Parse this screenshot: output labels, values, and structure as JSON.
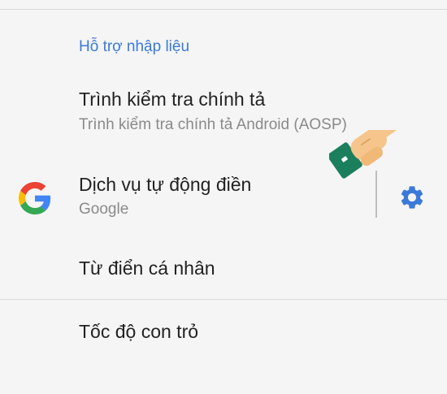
{
  "section": {
    "header": "Hỗ trợ nhập liệu"
  },
  "items": [
    {
      "title": "Trình kiểm tra chính tả",
      "subtitle": "Trình kiểm tra chính tả Android (AOSP)"
    },
    {
      "title": "Dịch vụ tự động điền",
      "subtitle": "Google",
      "icon": "google-g-icon",
      "action_icon": "gear-icon"
    },
    {
      "title": "Từ điển cá nhân"
    },
    {
      "title": "Tốc độ con trỏ"
    }
  ],
  "colors": {
    "background": "#f5f5f5",
    "accent": "#3b7ad9",
    "title_text": "#222222",
    "subtitle_text": "#8a8a8a",
    "gear": "#3b7ad9"
  }
}
